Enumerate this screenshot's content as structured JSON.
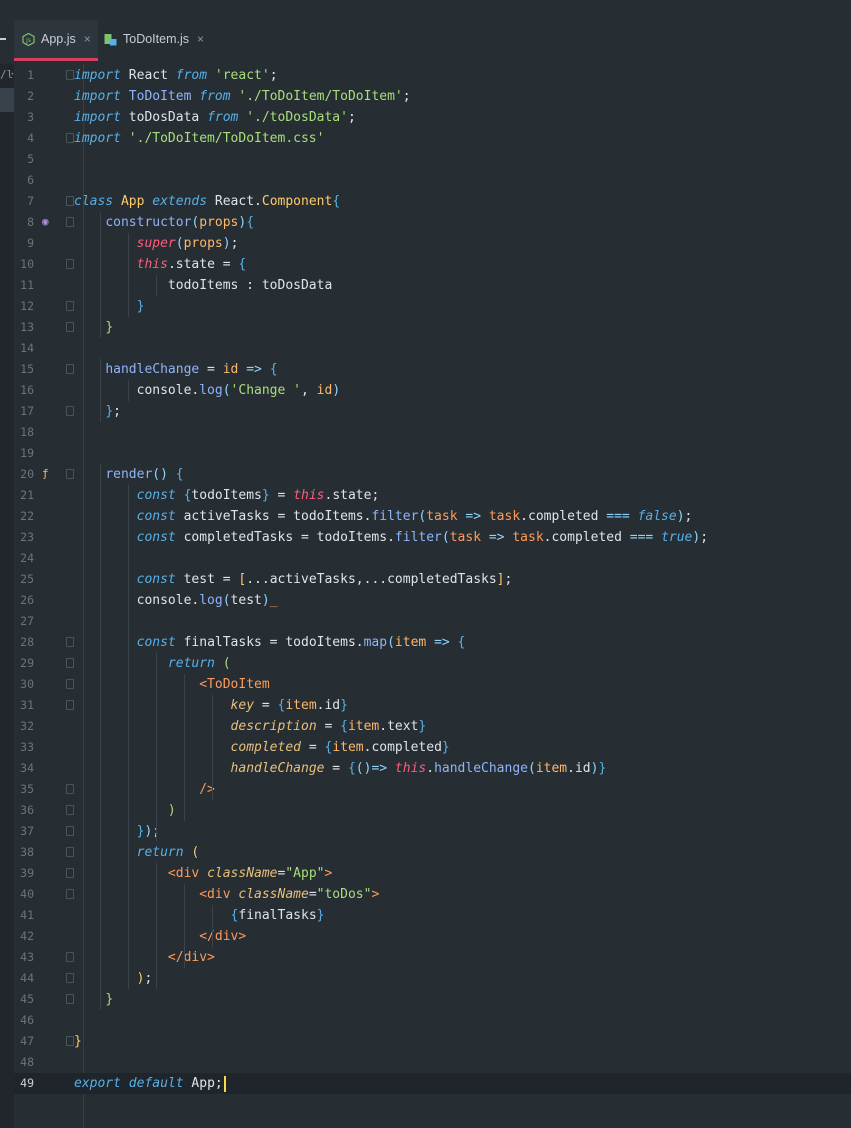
{
  "tabs": [
    {
      "label": "App.js",
      "close": "×",
      "active": true,
      "icon": "node-js-icon"
    },
    {
      "label": "ToDoItem.js",
      "close": "×",
      "active": false,
      "icon": "react-component-icon"
    }
  ],
  "sidebar": {
    "path_fragment": "/ŀ"
  },
  "gutter_icons": {
    "line8": "override-icon",
    "line20": "implements-icon"
  },
  "current_line": 49,
  "lines": [
    [
      [
        "k",
        "import"
      ],
      [
        "i",
        " React "
      ],
      [
        "k",
        "from"
      ],
      [
        "s",
        " 'react'"
      ],
      [
        "i",
        ";"
      ]
    ],
    [
      [
        "k",
        "import"
      ],
      [
        "f",
        " ToDoItem "
      ],
      [
        "k",
        "from"
      ],
      [
        "s",
        " './ToDoItem/ToDoItem'"
      ],
      [
        "i",
        ";"
      ]
    ],
    [
      [
        "k",
        "import"
      ],
      [
        "i",
        " toDosData "
      ],
      [
        "k",
        "from"
      ],
      [
        "s",
        " './toDosData'"
      ],
      [
        "i",
        ";"
      ]
    ],
    [
      [
        "k",
        "import"
      ],
      [
        "s",
        " './ToDoItem/ToDoItem.css'"
      ]
    ],
    [],
    [],
    [
      [
        "k",
        "class"
      ],
      [
        "c",
        " App "
      ],
      [
        "k",
        "extends"
      ],
      [
        "i",
        " React."
      ],
      [
        "c",
        "Component"
      ],
      [
        "b",
        "{"
      ]
    ],
    [
      [
        "i",
        "    "
      ],
      [
        "f",
        "constructor"
      ],
      [
        "o",
        "("
      ],
      [
        "p",
        "props"
      ],
      [
        "o",
        ")"
      ],
      [
        "b",
        "{"
      ]
    ],
    [
      [
        "i",
        "        "
      ],
      [
        "kc",
        "super"
      ],
      [
        "o",
        "("
      ],
      [
        "p",
        "props"
      ],
      [
        "o",
        ")"
      ],
      [
        "i",
        ";"
      ]
    ],
    [
      [
        "i",
        "        "
      ],
      [
        "kc",
        "this"
      ],
      [
        "i",
        ".state = "
      ],
      [
        "b",
        "{"
      ]
    ],
    [
      [
        "i",
        "            todoItems : toDosData"
      ]
    ],
    [
      [
        "i",
        "        "
      ],
      [
        "b",
        "}"
      ]
    ],
    [
      [
        "i",
        "    "
      ],
      [
        "j",
        "}"
      ]
    ],
    [],
    [
      [
        "i",
        "    "
      ],
      [
        "f",
        "handleChange"
      ],
      [
        "i",
        " = "
      ],
      [
        "p",
        "id"
      ],
      [
        "i",
        " "
      ],
      [
        "o",
        "=>"
      ],
      [
        "i",
        " "
      ],
      [
        "b",
        "{"
      ]
    ],
    [
      [
        "i",
        "        console."
      ],
      [
        "f",
        "log"
      ],
      [
        "o",
        "("
      ],
      [
        "s",
        "'Change '"
      ],
      [
        "i",
        ", "
      ],
      [
        "p",
        "id"
      ],
      [
        "o",
        ")"
      ]
    ],
    [
      [
        "i",
        "    "
      ],
      [
        "b",
        "}"
      ],
      [
        "i",
        ";"
      ]
    ],
    [],
    [],
    [
      [
        "i",
        "    "
      ],
      [
        "f",
        "render"
      ],
      [
        "o",
        "()"
      ],
      [
        "i",
        " "
      ],
      [
        "b",
        "{"
      ]
    ],
    [
      [
        "i",
        "        "
      ],
      [
        "k",
        "const"
      ],
      [
        "i",
        " "
      ],
      [
        "b",
        "{"
      ],
      [
        "i",
        "todoItems"
      ],
      [
        "b",
        "}"
      ],
      [
        "i",
        " = "
      ],
      [
        "kc",
        "this"
      ],
      [
        "i",
        ".state;"
      ]
    ],
    [
      [
        "i",
        "        "
      ],
      [
        "k",
        "const"
      ],
      [
        "i",
        " activeTasks = todoItems."
      ],
      [
        "f",
        "filter"
      ],
      [
        "o",
        "("
      ],
      [
        "t",
        "task"
      ],
      [
        "i",
        " "
      ],
      [
        "o",
        "=>"
      ],
      [
        "i",
        " "
      ],
      [
        "t",
        "task"
      ],
      [
        "i",
        ".completed "
      ],
      [
        "o",
        "==="
      ],
      [
        "i",
        " "
      ],
      [
        "k",
        "false"
      ],
      [
        "o",
        ")"
      ],
      [
        "i",
        ";"
      ]
    ],
    [
      [
        "i",
        "        "
      ],
      [
        "k",
        "const"
      ],
      [
        "i",
        " completedTasks = todoItems."
      ],
      [
        "f",
        "filter"
      ],
      [
        "o",
        "("
      ],
      [
        "t",
        "task"
      ],
      [
        "i",
        " "
      ],
      [
        "o",
        "=>"
      ],
      [
        "i",
        " "
      ],
      [
        "t",
        "task"
      ],
      [
        "i",
        ".completed "
      ],
      [
        "o",
        "==="
      ],
      [
        "i",
        " "
      ],
      [
        "k",
        "true"
      ],
      [
        "o",
        ")"
      ],
      [
        "i",
        ";"
      ]
    ],
    [],
    [
      [
        "i",
        "        "
      ],
      [
        "k",
        "const"
      ],
      [
        "i",
        " test = "
      ],
      [
        "c",
        "["
      ],
      [
        "i",
        "...activeTasks,...completedTasks"
      ],
      [
        "c",
        "]"
      ],
      [
        "i",
        ";"
      ]
    ],
    [
      [
        "i",
        "        console."
      ],
      [
        "f",
        "log"
      ],
      [
        "o",
        "("
      ],
      [
        "i",
        "test"
      ],
      [
        "o",
        ")"
      ],
      [
        "brf",
        "_"
      ]
    ],
    [],
    [
      [
        "i",
        "        "
      ],
      [
        "k",
        "const"
      ],
      [
        "i",
        " finalTasks = todoItems."
      ],
      [
        "f",
        "map"
      ],
      [
        "o",
        "("
      ],
      [
        "p",
        "item"
      ],
      [
        "i",
        " "
      ],
      [
        "o",
        "=>"
      ],
      [
        "i",
        " "
      ],
      [
        "b",
        "{"
      ]
    ],
    [
      [
        "i",
        "            "
      ],
      [
        "k",
        "return"
      ],
      [
        "i",
        " "
      ],
      [
        "j",
        "("
      ]
    ],
    [
      [
        "i",
        "                "
      ],
      [
        "t",
        "<ToDoItem"
      ]
    ],
    [
      [
        "i",
        "                    "
      ],
      [
        "a",
        "key"
      ],
      [
        "i",
        " = "
      ],
      [
        "b",
        "{"
      ],
      [
        "p",
        "item"
      ],
      [
        "i",
        ".id"
      ],
      [
        "b",
        "}"
      ]
    ],
    [
      [
        "i",
        "                    "
      ],
      [
        "a",
        "description"
      ],
      [
        "i",
        " = "
      ],
      [
        "b",
        "{"
      ],
      [
        "p",
        "item"
      ],
      [
        "i",
        ".text"
      ],
      [
        "b",
        "}"
      ]
    ],
    [
      [
        "i",
        "                    "
      ],
      [
        "a",
        "completed"
      ],
      [
        "i",
        " = "
      ],
      [
        "b",
        "{"
      ],
      [
        "p",
        "item"
      ],
      [
        "i",
        ".completed"
      ],
      [
        "b",
        "}"
      ]
    ],
    [
      [
        "i",
        "                    "
      ],
      [
        "a",
        "handleChange"
      ],
      [
        "i",
        " = "
      ],
      [
        "b",
        "{"
      ],
      [
        "o",
        "()"
      ],
      [
        "o",
        "=>"
      ],
      [
        "i",
        " "
      ],
      [
        "kc",
        "this"
      ],
      [
        "i",
        "."
      ],
      [
        "f",
        "handleChange"
      ],
      [
        "o",
        "("
      ],
      [
        "p",
        "item"
      ],
      [
        "i",
        ".id"
      ],
      [
        "o",
        ")"
      ],
      [
        "b",
        "}"
      ]
    ],
    [
      [
        "i",
        "                "
      ],
      [
        "t",
        "/>"
      ]
    ],
    [
      [
        "i",
        "            "
      ],
      [
        "j",
        ")"
      ]
    ],
    [
      [
        "i",
        "        "
      ],
      [
        "b",
        "}"
      ],
      [
        "o",
        ")"
      ],
      [
        "i",
        ";"
      ]
    ],
    [
      [
        "i",
        "        "
      ],
      [
        "k",
        "return"
      ],
      [
        "i",
        " "
      ],
      [
        "c",
        "("
      ]
    ],
    [
      [
        "i",
        "            "
      ],
      [
        "t",
        "<div"
      ],
      [
        "i",
        " "
      ],
      [
        "a",
        "className"
      ],
      [
        "i",
        "="
      ],
      [
        "s",
        "\"App\""
      ],
      [
        "t",
        ">"
      ]
    ],
    [
      [
        "i",
        "                "
      ],
      [
        "t",
        "<div"
      ],
      [
        "i",
        " "
      ],
      [
        "a",
        "className"
      ],
      [
        "i",
        "="
      ],
      [
        "s",
        "\"toDos\""
      ],
      [
        "t",
        ">"
      ]
    ],
    [
      [
        "i",
        "                    "
      ],
      [
        "b",
        "{"
      ],
      [
        "i",
        "finalTasks"
      ],
      [
        "b",
        "}"
      ]
    ],
    [
      [
        "i",
        "                "
      ],
      [
        "t",
        "</div>"
      ]
    ],
    [
      [
        "i",
        "            "
      ],
      [
        "t",
        "</div>"
      ]
    ],
    [
      [
        "i",
        "        "
      ],
      [
        "c",
        ")"
      ],
      [
        "i",
        ";"
      ]
    ],
    [
      [
        "i",
        "    "
      ],
      [
        "j",
        "}"
      ]
    ],
    [],
    [
      [
        "c",
        "}"
      ]
    ],
    [],
    [
      [
        "k",
        "export"
      ],
      [
        "i",
        " "
      ],
      [
        "k",
        "default"
      ],
      [
        "i",
        " App;"
      ]
    ]
  ]
}
